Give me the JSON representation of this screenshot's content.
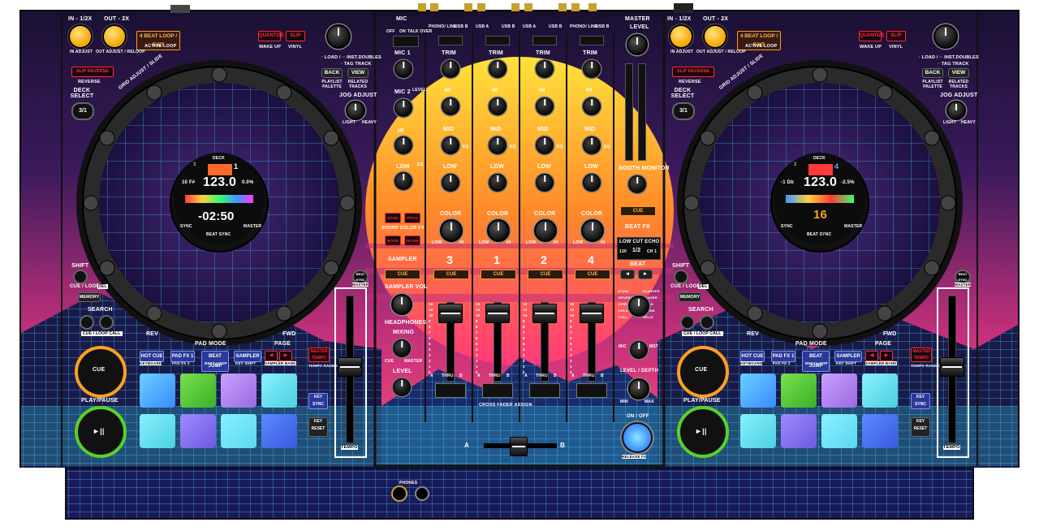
{
  "colors": {
    "accent_red": "#ff2a2a",
    "accent_orange": "#ff9a1a",
    "grid_cyan": "#3de8ff",
    "sun_yellow": "#ffd23a",
    "magenta": "#e0308a"
  },
  "left_deck": {
    "in_label": "IN - 1/2X",
    "out_label": "OUT - 2X",
    "beat_loop": "4 BEAT LOOP / EXIT",
    "in_adjust": "IN ADJUST",
    "out_adjust": "OUT ADJUST / RELOOP",
    "active_loop": "ACTIVE LOOP",
    "quantize": "QUANTIZE",
    "slip": "SLIP",
    "wake_up": "WAKE UP",
    "vinyl": "VINYL",
    "slip_reverse": "SLIP REVERSE",
    "reverse": "REVERSE",
    "load_text": "· LOAD / ·· INST.DOUBLES",
    "tag_track": "· TAG TRACK",
    "back": "BACK",
    "view": "VIEW",
    "playlist_palette": "PLAYLIST PALETTE",
    "related_tracks": "RELATED TRACKS",
    "deck_select": "DECK SELECT",
    "deck_num": "3/1",
    "jog_adjust": "JOG ADJUST",
    "light": "LIGHT",
    "heavy": "HEAVY",
    "grid_adjust": "GRID ADJUST / SLIDE",
    "shift": "SHIFT",
    "cue_loop": "CUE / LOOP",
    "del": "DEL",
    "memory": "MEMORY",
    "search": "SEARCH",
    "cue_loop_call": "CUE / LOOP CALL",
    "rev": "REV",
    "fwd": "FWD",
    "pad_mode": "PAD MODE",
    "page": "PAGE",
    "hot_cue": "HOT CUE",
    "pad_fx1": "PAD FX 1",
    "beat_jump": "BEAT JUMP",
    "sampler": "SAMPLER",
    "keyboard": "KEYBOARD",
    "pad_fx2": "PAD FX 2",
    "beat_loop_mode": "BEAT LOOP",
    "key_shift": "KEY SHIFT",
    "sampler_bank": "SAMPLER BANK",
    "master_tempo": "MASTER TEMPO",
    "tempo_range": "TEMPO RANGE",
    "cue": "CUE",
    "play_pause": "PLAY/PAUSE",
    "key_sync": "KEY SYNC",
    "key_reset": "KEY RESET",
    "tempo": "TEMPO",
    "beat_sync": "BEAT SYNC",
    "master": "MASTER",
    "jog_display": {
      "deck_label": "DECK",
      "deck_num": "1",
      "deck_other": "3",
      "bpm": "123.0",
      "key": "10 F#",
      "pitch": "0.0%",
      "time": "-02:50",
      "sync": "SYNC",
      "beat_sync": "BEAT SYNC",
      "master": "MASTER"
    }
  },
  "right_deck": {
    "deck_num": "3/1",
    "jog_display": {
      "deck_label": "DECK",
      "deck_num": "4",
      "deck_other": "2",
      "bpm": "123.0",
      "key": "-1 Db",
      "pitch": "-2.5%",
      "loop": "16",
      "sync": "SYNC",
      "beat_sync": "BEAT SYNC",
      "master": "MASTER"
    }
  },
  "mixer": {
    "mic": "MIC",
    "mic_switch": [
      "OFF",
      "ON",
      "TALK OVER"
    ],
    "mic1": "MIC 1",
    "mic2": "MIC 2",
    "level": "LEVEL",
    "hi": "HI",
    "low": "LOW",
    "eq": "EQ",
    "echo": "ECHO",
    "pitch": "PITCH",
    "noise": "NOISE",
    "filter": "FILTER",
    "sound_color_fx": "SOUND COLOR FX",
    "sampler": "SAMPLER",
    "cue": "CUE",
    "sampler_vol": "SAMPLER VOL",
    "headphones": "HEADPHONES",
    "mixing": "MIXING",
    "master_label": "MASTER",
    "input_phono": [
      "PHONO/ LINE",
      "USB B"
    ],
    "input_usb": [
      "USB A",
      "LINE",
      "USB B"
    ],
    "trim": "TRIM",
    "mid": "MID",
    "color": "COLOR",
    "channels": [
      "3",
      "1",
      "2",
      "4"
    ],
    "booth_monitor": "BOOTH MONITOR",
    "beat_fx": "BEAT FX",
    "fx_display": {
      "title": "LOW CUT ECHO",
      "bpm": "120",
      "beat": "1/2",
      "ch": "CH 1"
    },
    "beat": "BEAT",
    "fx_list": [
      "ECHO",
      "REVERB",
      "SPIRAL",
      "DELAY",
      "ROLL",
      "FLANGER",
      "PHASER",
      "PITCH",
      "TRANS",
      "HELIX"
    ],
    "mic_mst": [
      "MIC",
      "MST"
    ],
    "level_depth": "LEVEL / DEPTH",
    "min": "MIN",
    "max": "MAX",
    "on_off": "ON / OFF",
    "release_fx": "RELEASE FX",
    "cross_fader_assign": "CROSS FADER ASSIGN",
    "thru": "THRU",
    "a": "A",
    "b": "B",
    "phones": "PHONES",
    "meter": [
      "15",
      "12",
      "10",
      "9",
      "8",
      "7",
      "6",
      "5",
      "4",
      "3",
      "2",
      "1",
      "0"
    ],
    "meter_vu": [
      "15",
      "10",
      "6",
      "4",
      "2",
      "1",
      "-3",
      "-6",
      "-9",
      "-12",
      "-15",
      "-18",
      "-24"
    ]
  }
}
